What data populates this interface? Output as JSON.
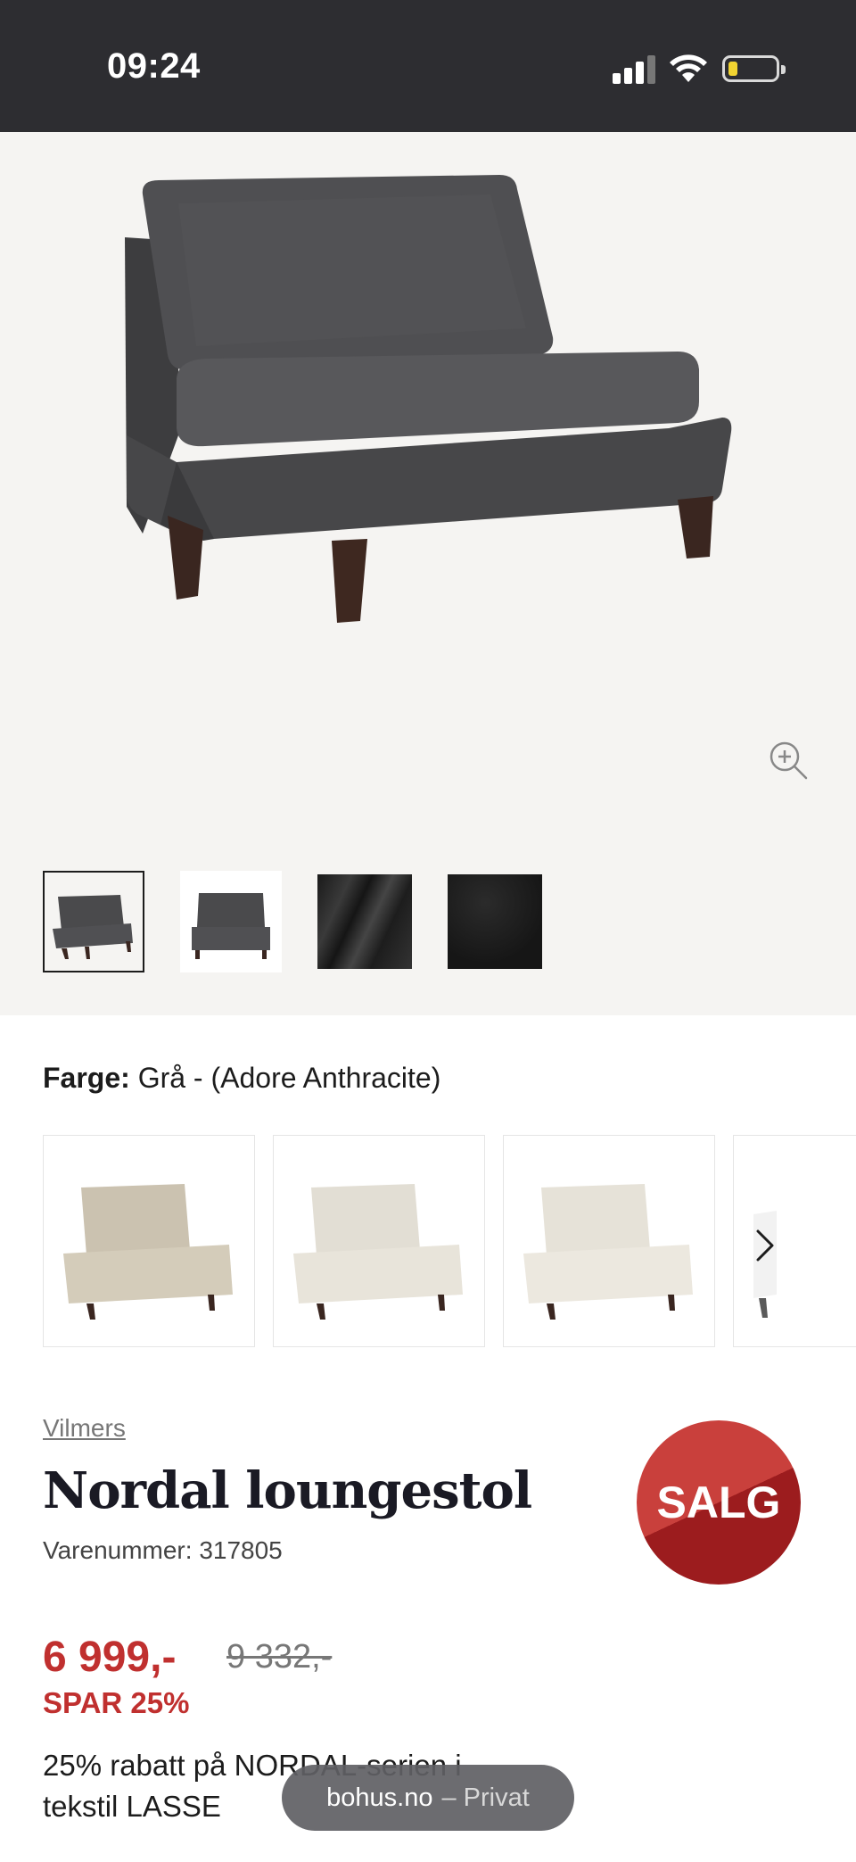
{
  "status_bar": {
    "time": "09:24"
  },
  "gallery": {
    "thumbnails": [
      "chair-angle",
      "chair-front",
      "fabric-drape",
      "fabric-swatch"
    ],
    "active_index": 0
  },
  "color": {
    "label": "Farge:",
    "value": "Grå - (Adore Anthracite)",
    "swatch_tones": [
      "#cfc6b4",
      "#e4e1d8",
      "#e8e5dc"
    ]
  },
  "product": {
    "brand": "Vilmers",
    "title": "Nordal loungestol",
    "sku": "Varenummer: 317805",
    "sale_badge": "SALG"
  },
  "pricing": {
    "price": "6 999,-",
    "old_price": "9 332,-",
    "savings": "SPAR 25%",
    "promo_text": "25% rabatt på NORDAL-serien i tekstil LASSE"
  },
  "browser_pill": {
    "domain": "bohus.no",
    "mode": "– Privat"
  },
  "colors": {
    "status_bar_bg": "#2d2d31",
    "gallery_bg": "#f5f4f2",
    "sale_red": "#c0302f",
    "chair_fabric": "#4a4a4c"
  }
}
